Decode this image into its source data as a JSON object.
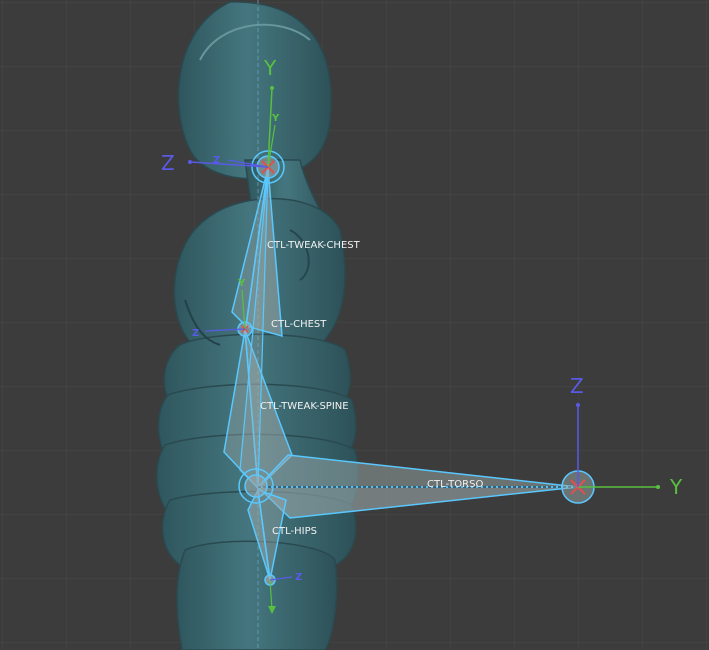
{
  "viewport": {
    "colors": {
      "background": "#3c3c3c",
      "grid": "#474747",
      "mesh": "#3f6f78",
      "mesh_dark": "#2e555d",
      "bone_fill": "#9aa7a8",
      "bone_outline": "#59c8ff",
      "axis_x": "#e05050",
      "axis_y": "#58c040",
      "axis_z": "#5a5ae6"
    },
    "bones": {
      "tweak_chest": "CTL-TWEAK-CHEST",
      "chest": "CTL-CHEST",
      "tweak_spine": "CTL-TWEAK-SPINE",
      "torso": "CTL-TORSO",
      "hips": "CTL-HIPS"
    },
    "gizmos": {
      "top": {
        "y": "Y",
        "z": "Z",
        "small_y": "Y",
        "small_z": "Z"
      },
      "chest": {
        "small_y": "Y",
        "small_z": "Z"
      },
      "torso": {
        "y": "Y",
        "z": "Z"
      },
      "hips": {
        "small_z": "Z"
      }
    }
  }
}
